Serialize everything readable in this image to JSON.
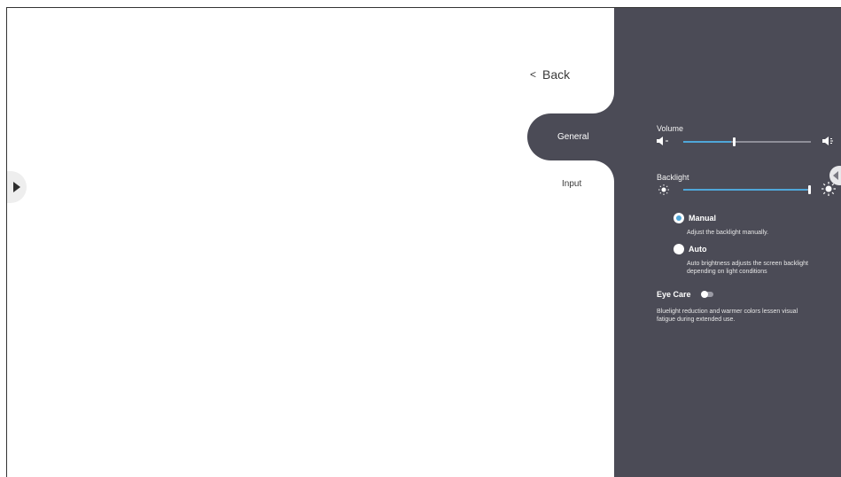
{
  "nav": {
    "back_label": "Back",
    "tabs": [
      {
        "label": "General",
        "active": true
      },
      {
        "label": "Input",
        "active": false
      }
    ]
  },
  "settings": {
    "volume": {
      "label": "Volume",
      "level": 0.4
    },
    "backlight": {
      "label": "Backlight",
      "level": 1.0
    },
    "backlight_mode": {
      "manual": {
        "label": "Manual",
        "description": "Adjust the backlight manually.",
        "selected": true
      },
      "auto": {
        "label": "Auto",
        "description_line1": "Auto brightness adjusts the screen backlight",
        "description_line2": "depending on light conditions",
        "selected": false
      }
    },
    "eye_care": {
      "label": "Eye Care",
      "enabled": false,
      "description_line1": "Bluelight reduction and warmer colors lessen visual",
      "description_line2": "fatigue during extended use."
    }
  },
  "colors": {
    "panel": "#4b4b56",
    "accent": "#4fa7d9",
    "track": "#8e8e98"
  },
  "icons": [
    "play-icon",
    "chevron-left-icon",
    "volume-low-icon",
    "volume-high-icon",
    "brightness-low-icon",
    "brightness-high-icon",
    "collapse-arrow-icon"
  ]
}
